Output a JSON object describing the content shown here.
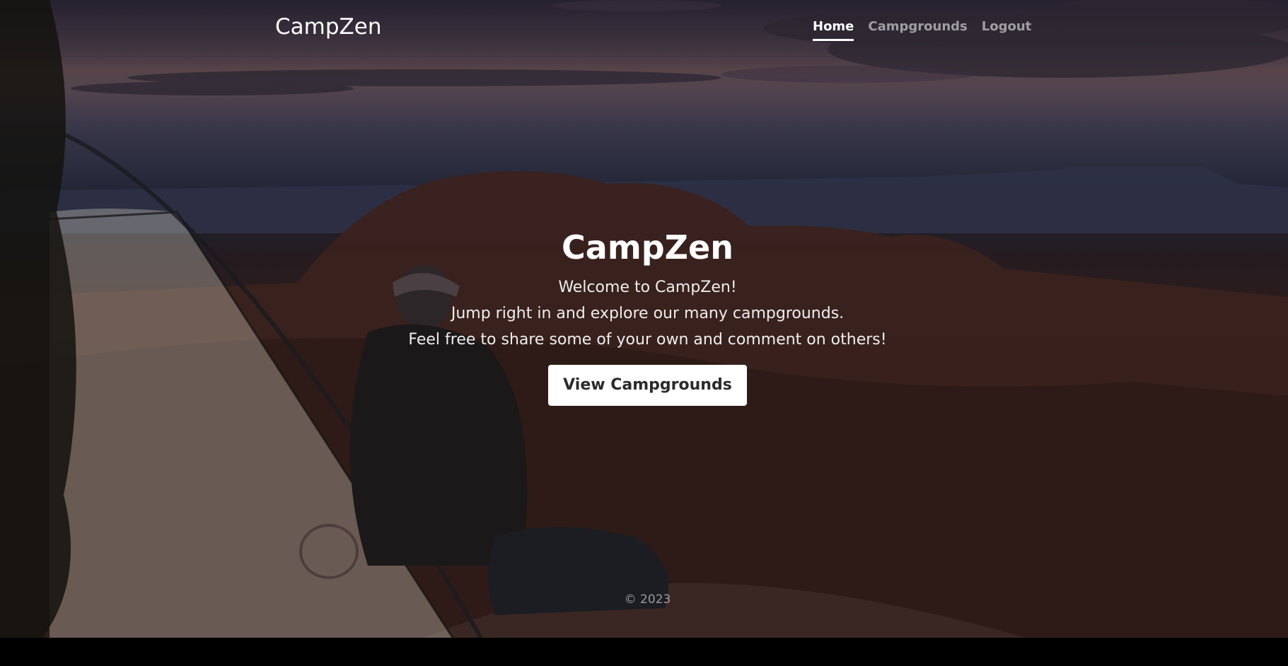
{
  "navbar": {
    "brand": "CampZen",
    "links": [
      {
        "label": "Home",
        "active": true
      },
      {
        "label": "Campgrounds",
        "active": false
      },
      {
        "label": "Logout",
        "active": false
      }
    ]
  },
  "hero": {
    "title": "CampZen",
    "lines": [
      "Welcome to CampZen!",
      "Jump right in and explore our many campgrounds.",
      "Feel free to share some of your own and comment on others!"
    ],
    "cta_label": "View Campgrounds"
  },
  "footer": {
    "text": "© 2023"
  },
  "colors": {
    "text": "#ffffff",
    "nav_inactive": "rgba(255,255,255,0.55)",
    "button_bg": "#ffffff",
    "button_text": "#2b2b2b",
    "bottom_bar": "#000000"
  }
}
